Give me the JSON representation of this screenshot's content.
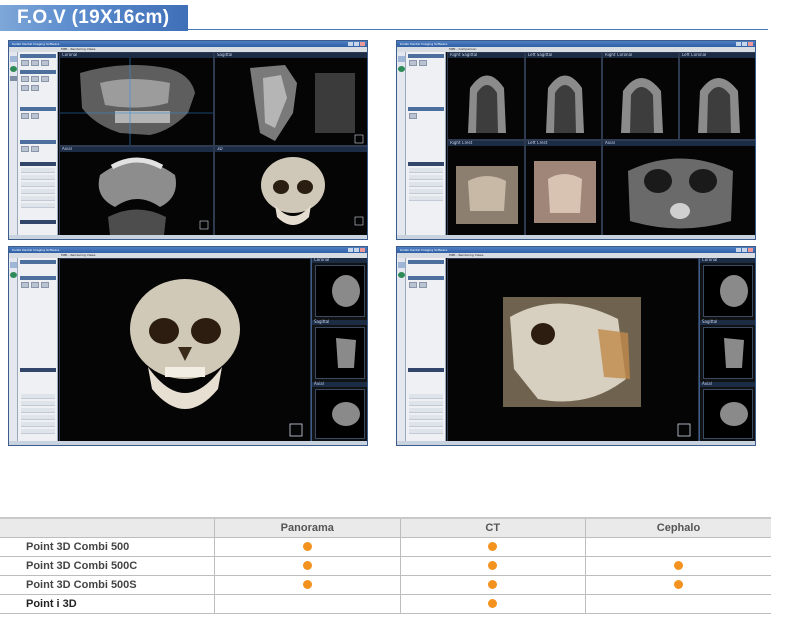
{
  "header": {
    "title": "F.O.V (19X16cm)"
  },
  "colors": {
    "banner": "#5f8fcf",
    "dot": "#f3921e",
    "accent_blue": "#3da2ff"
  },
  "screenshots": [
    {
      "app_title": "Kodak Dental Imaging Software",
      "tab": "MPR - Rendering Views",
      "views": [
        "Coronal",
        "Sagittal",
        "Axial",
        "3D"
      ]
    },
    {
      "app_title": "Kodak Dental Imaging Software",
      "tab": "MPR - Comparison",
      "views": [
        "Right Sagittal",
        "Left Sagittal",
        "Right Coronal",
        "Left Coronal",
        "Right Crest",
        "Left Crest",
        "Axial"
      ]
    },
    {
      "app_title": "Kodak Dental Imaging Software",
      "tab": "MPR - Rendering Views",
      "views": [
        "Coronal",
        "Sagittal",
        "Axial"
      ]
    },
    {
      "app_title": "Kodak Dental Imaging Software",
      "tab": "MPR - Rendering Views",
      "views": [
        "Coronal",
        "Sagittal",
        "Axial"
      ]
    }
  ],
  "table": {
    "columns": [
      "",
      "Panorama",
      "CT",
      "Cephalo"
    ],
    "rows": [
      {
        "name": "Point 3D Combi 500",
        "panorama": true,
        "ct": true,
        "cephalo": false
      },
      {
        "name": "Point 3D Combi 500C",
        "panorama": true,
        "ct": true,
        "cephalo": true
      },
      {
        "name": "Point 3D Combi 500S",
        "panorama": true,
        "ct": true,
        "cephalo": true
      },
      {
        "name": "Point i 3D",
        "panorama": false,
        "ct": true,
        "cephalo": false
      }
    ]
  }
}
